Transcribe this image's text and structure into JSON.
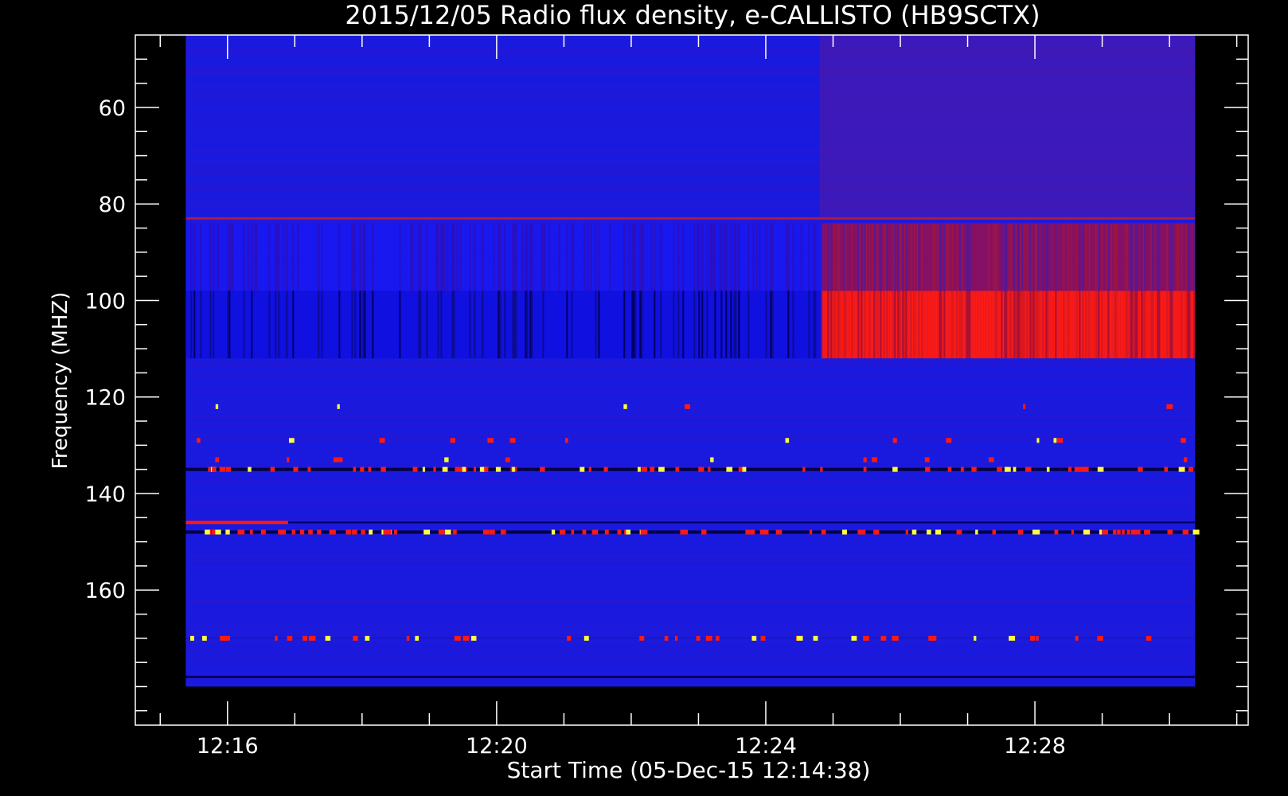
{
  "chart_data": {
    "type": "heatmap",
    "title": "2015/12/05  Radio flux density, e-CALLISTO (HB9SCTX)",
    "xlabel": "Start Time (05-Dec-15 12:14:38)",
    "ylabel": "Frequency (MHZ)",
    "x_ticks": [
      "12:16",
      "12:20",
      "12:24",
      "12:28"
    ],
    "x_tick_values_min": [
      736,
      740,
      744,
      748
    ],
    "xlim_min": [
      734.63,
      751.17
    ],
    "data_extent_min": [
      735.38,
      750.38
    ],
    "y_ticks": [
      60,
      80,
      100,
      120,
      140,
      160
    ],
    "ylim": [
      45,
      188
    ],
    "data_extent_freq": [
      45,
      180
    ],
    "y_inverted": true,
    "grid": false,
    "colors": {
      "background": "#000000",
      "axes": "#ffffff",
      "quiet_level": "#1a1adf",
      "strong_level": "#ff1a10",
      "peak_level": "#ffff40",
      "dark_level": "#000040"
    },
    "features": {
      "onset_time_min": 744.8,
      "band_84_98": [
        84,
        98
      ],
      "band_98_112": [
        98,
        112
      ],
      "horizontal_lines_freq": [
        83,
        135,
        146,
        148,
        170,
        178
      ]
    }
  }
}
